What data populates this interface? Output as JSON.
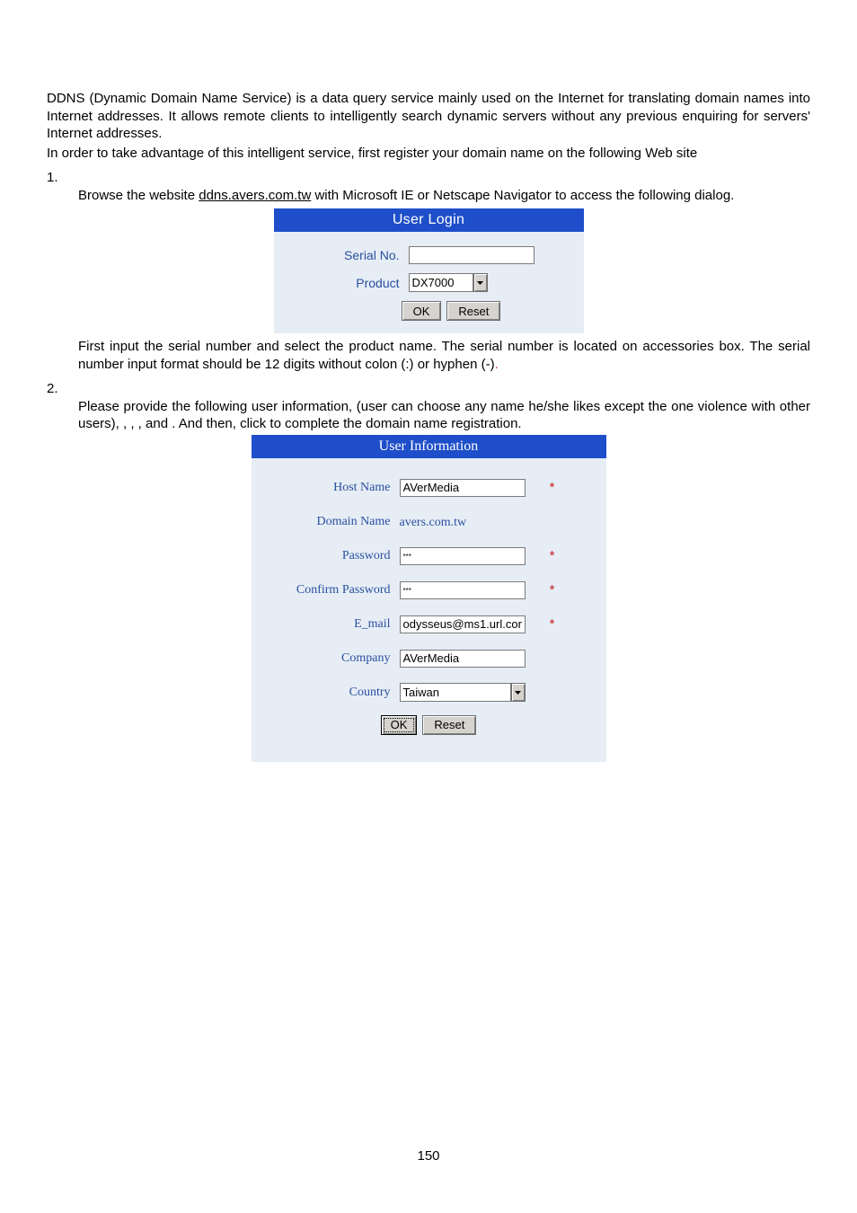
{
  "intro": {
    "p1": "DDNS (Dynamic Domain Name Service) is a data query service mainly used on the Internet for translating domain names into Internet addresses.   It allows remote clients to intelligently search dynamic servers without any previous enquiring for servers' Internet addresses.",
    "p2": "In order to take advantage of this intelligent service, first register your domain name on the following Web site"
  },
  "step1": {
    "num": "1.",
    "body_a": "Browse the website ",
    "url": "ddns.avers.com.tw",
    "body_b": " with Microsoft IE or Netscape Navigator to access the following dialog.",
    "body_after_a": "First input the serial number and select the product name. The serial number is located on accessories box. The serial number input format should be 12 digits without colon (:) or hyphen (-)",
    "body_after_dot": "."
  },
  "login": {
    "title": "User Login",
    "serial_label": "Serial No.",
    "serial_value": "",
    "product_label": "Product",
    "product_value": "DX7000",
    "ok": "OK",
    "reset": "Reset"
  },
  "step2": {
    "num": "2.",
    "body": "Please provide the following user information,                (user can choose any name he/she likes except the one violence with other users),                ,            ,                  , and            . And then, click           to complete the domain name registration."
  },
  "info": {
    "title": "User Information",
    "host_label": "Host Name",
    "host_value": "AVerMedia",
    "domain_label": "Domain Name",
    "domain_value": "avers.com.tw",
    "password_label": "Password",
    "password_value": "***",
    "confirm_label": "Confirm Password",
    "confirm_value": "***",
    "email_label": "E_mail",
    "email_value": "odysseus@ms1.url.cor",
    "company_label": "Company",
    "company_value": "AVerMedia",
    "country_label": "Country",
    "country_value": "Taiwan",
    "ok": "OK",
    "reset": "Reset",
    "star": "*"
  },
  "page_number": "150"
}
